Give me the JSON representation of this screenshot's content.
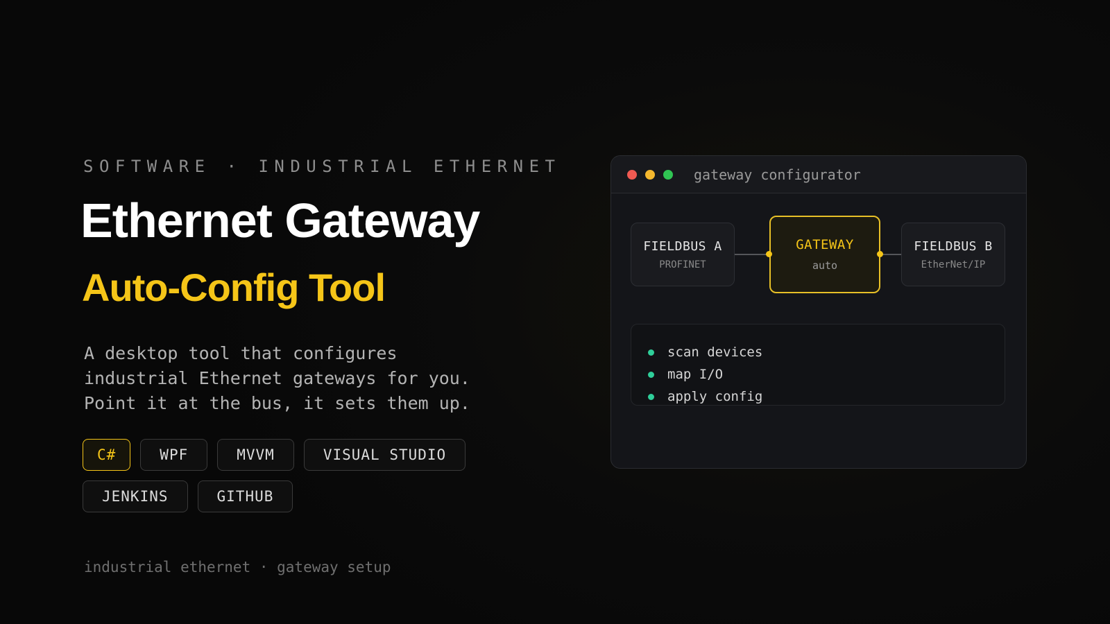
{
  "eyebrow": "SOFTWARE · INDUSTRIAL ETHERNET",
  "title": "Ethernet Gateway",
  "subtitle": "Auto-Config Tool",
  "description": [
    "A desktop tool that configures",
    "industrial Ethernet gateways for you.",
    "Point it at the bus, it sets them up."
  ],
  "tags": [
    "C#",
    "WPF",
    "MVVM",
    "VISUAL STUDIO",
    "JENKINS",
    "GITHUB"
  ],
  "footer": "industrial ethernet · gateway setup",
  "window": {
    "title": "gateway configurator",
    "nodes": {
      "fieldbus_a": {
        "name": "FIELDBUS A",
        "protocol": "PROFINET"
      },
      "gateway": {
        "name": "GATEWAY",
        "mode": "auto"
      },
      "fieldbus_b": {
        "name": "FIELDBUS B",
        "protocol": "EtherNet/IP"
      }
    },
    "steps": [
      "scan devices",
      "map I/O",
      "apply config"
    ]
  },
  "colors": {
    "accent": "#f5c518",
    "step_bullet": "#2fcf9a",
    "traffic_red": "#f05a52",
    "traffic_yellow": "#f5b82e",
    "traffic_green": "#30c553"
  }
}
